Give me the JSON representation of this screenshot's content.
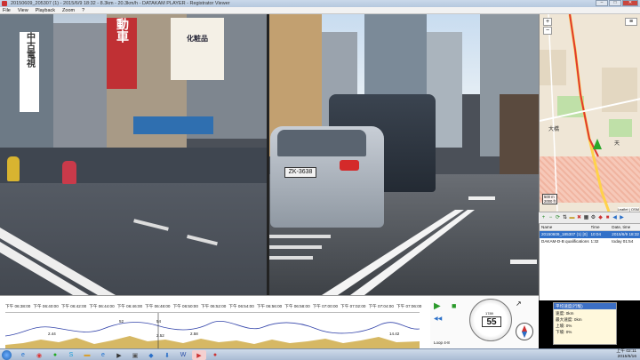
{
  "window": {
    "title": "20150609_205307 (1) - 2015/6/9 18:32 - 8.3km - 20.3km/h - DATAKAM PLAYER - Registrator Viewer",
    "controls": [
      "–",
      "□",
      "✕"
    ]
  },
  "menu": [
    "File",
    "View",
    "Playback",
    "Zoom",
    "?"
  ],
  "video": {
    "signs": [
      "中古電視",
      "動車",
      "化粧品",
      "ZK-3638"
    ]
  },
  "map": {
    "zoom_in": "+",
    "zoom_out": "−",
    "labels": [
      "大橋",
      "天"
    ],
    "scale": [
      "500 m",
      "2000 ft"
    ],
    "attribution": "Leaflet | OSM",
    "accent": "#e03a2f",
    "marker_color": "#2aa82a"
  },
  "map_toolbar": [
    "plus-icon",
    "minus-icon",
    "refresh-icon",
    "sort-icon",
    "folder-icon",
    "delete-icon",
    "film-icon",
    "settings-icon",
    "info-icon",
    "export-icon",
    "back-icon",
    "forward-icon"
  ],
  "file_list": {
    "headers": [
      "Name",
      "Time",
      "Date, time"
    ],
    "rows": [
      {
        "name": "20150609_185307 (1) [0]",
        "time": "10:04",
        "date": "2015/6/9 18:32"
      },
      {
        "name": "DAKAM-D-B qualifications",
        "time": "1:32",
        "date": "today 01:54"
      }
    ]
  },
  "timeline": {
    "ticks": [
      "下午 06:38:00",
      "下午 06:40:00",
      "下午 06:42:00",
      "下午 06:44:00",
      "下午 06:46:00",
      "下午 06:48:00",
      "下午 06:50:00",
      "下午 06:52:00",
      "下午 06:54:00",
      "下午 06:56:00",
      "下午 06:58:00",
      "下午 07:00:00",
      "下午 07:02:00",
      "下午 07:04:00",
      "下午 07:06:00"
    ],
    "markers": [
      "2.44",
      "52",
      "54",
      "2.52",
      "2.58",
      "14.42"
    ]
  },
  "controls": {
    "play": "▶",
    "stop": "■",
    "rewind": "◀◀",
    "loop_label": "Loop 4-8",
    "speed": "55",
    "odometer": "1789"
  },
  "sensor": {
    "header": "平均速度(行駛)",
    "rows": [
      "速度: 0km",
      "最大速度: 0km",
      "上坡: 0%",
      "下坡: 0%"
    ]
  },
  "taskbar": {
    "icons": [
      "windows-icon",
      "ie-icon",
      "chrome-icon",
      "line-icon",
      "skype-icon",
      "folder-icon",
      "explorer-icon",
      "media-icon",
      "photo-icon",
      "app-icon",
      "download-icon",
      "word-icon",
      "player-icon",
      "record-icon"
    ],
    "time": "上午 02:11",
    "date": "2015/6/16"
  }
}
